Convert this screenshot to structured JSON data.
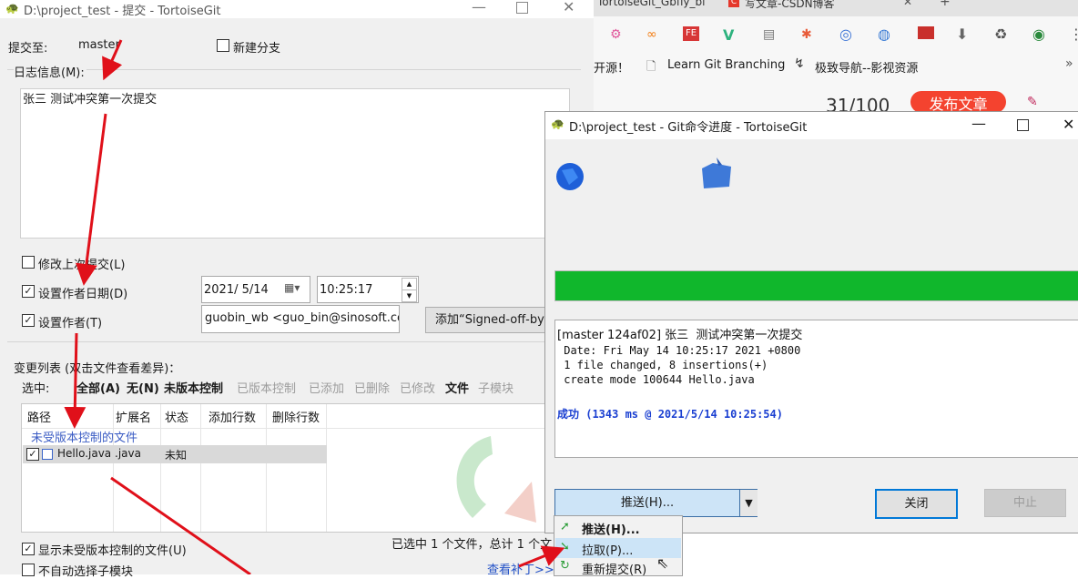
{
  "commit_dialog": {
    "title": "D:\\project_test - 提交 - TortoiseGit",
    "commit_to_label": "提交至:",
    "branch": "master",
    "new_branch_label": "新建分支",
    "log_message_label": "日志信息(M):",
    "log_message": "张三  测试冲突第一次提交",
    "amend_label": "修改上次提交(L)",
    "set_date_label": "设置作者日期(D)",
    "date_value": "2021/  5/14",
    "time_value": "10:25:17",
    "set_author_label": "设置作者(T)",
    "author_value": "guobin_wb <guo_bin@sinosoft.com.",
    "signed_off_button": "添加“Signed-off-by”",
    "changes_label": "变更列表 (双击文件查看差异)：",
    "select_label": "选中:",
    "filters_active": [
      "全部(A)",
      "无(N)",
      "未版本控制"
    ],
    "filters_inactive": [
      "已版本控制",
      "已添加",
      "已删除",
      "已修改"
    ],
    "filter_files": "文件",
    "filter_submodules": "子模块",
    "columns": [
      "路径",
      "扩展名",
      "状态",
      "添加行数",
      "删除行数"
    ],
    "group_header": "未受版本控制的文件",
    "rows": [
      {
        "path": "Hello.java",
        "ext": ".java",
        "status": "未知",
        "added": "",
        "deleted": ""
      }
    ],
    "show_unversioned_label": "显示未受版本控制的文件(U)",
    "no_auto_submodule_label": "不自动选择子模块",
    "selection_summary": "已选中 1 个文件，总计 1 个文",
    "view_patch_link": "查看补丁>>"
  },
  "browser": {
    "tabs": [
      "TortoiseGit_Gbfly_bl",
      "写文章-CSDN博客"
    ],
    "bookmarks": [
      "开源！",
      "Learn Git Branching",
      "极致导航--影视资源"
    ],
    "counter": "31/100",
    "publish_button": "发布文章"
  },
  "progress_dialog": {
    "title": "D:\\project_test - Git命令进度 - TortoiseGit",
    "progress_percent": 100,
    "progress_color": "#10b72c",
    "output_lines": [
      "[master 124af02] 张三  测试冲突第一次提交",
      " Date: Fri May 14 10:25:17 2021 +0800",
      " 1 file changed, 8 insertions(+)",
      " create mode 100644 Hello.java"
    ],
    "success_line": "成功 (1343 ms @ 2021/5/14 10:25:54)",
    "push_button": "推送(H)...",
    "close_button": "关闭",
    "abort_button": "中止"
  },
  "dropdown_menu": {
    "items": [
      "推送(H)...",
      "拉取(P)...",
      "重新提交(R)"
    ]
  },
  "colors": {
    "annotation_arrow": "#e0101a",
    "success_text": "#1a3fd1",
    "menu_highlight": "#cce4f7",
    "split_button": "#cde4f7"
  }
}
